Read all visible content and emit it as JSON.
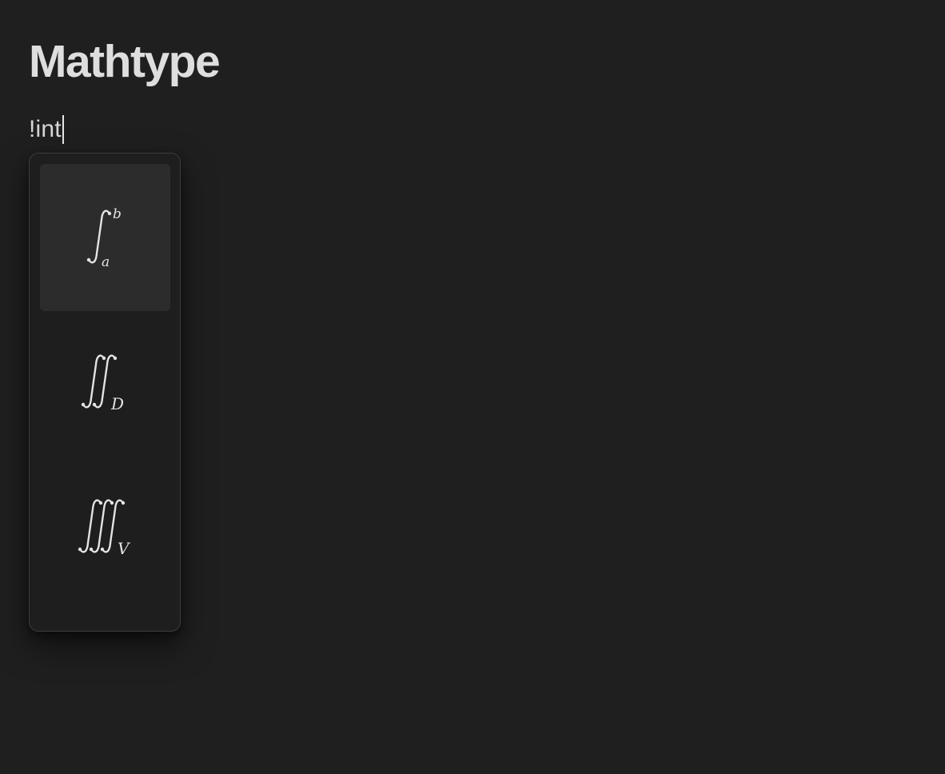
{
  "document": {
    "title": "Mathtype",
    "editor_text": "!int"
  },
  "suggestions": {
    "selected_index": 0,
    "items": [
      {
        "id": "definite-integral",
        "integral_count": 1,
        "upper": "b",
        "lower": "a"
      },
      {
        "id": "double-integral",
        "integral_count": 2,
        "upper": "",
        "lower": "D"
      },
      {
        "id": "triple-integral",
        "integral_count": 3,
        "upper": "",
        "lower": "V"
      }
    ]
  },
  "colors": {
    "background": "#1f1f1f",
    "menu_border": "#3c3c3c",
    "selected_item": "#2c2c2c",
    "text": "#dadada"
  }
}
